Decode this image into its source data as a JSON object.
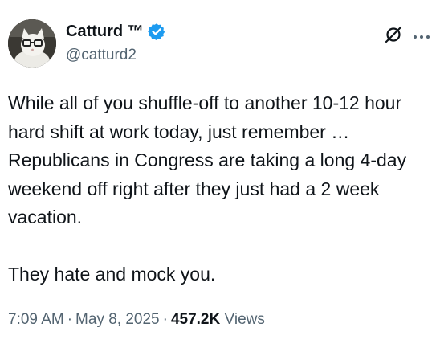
{
  "author": {
    "display_name": "Catturd ™",
    "handle": "@catturd2",
    "verified": true,
    "verified_color": "#1d9bf0"
  },
  "icons": {
    "verified": "verified-badge-icon",
    "grok": "grok-icon",
    "more": "more-options-icon"
  },
  "tweet": {
    "text": "While all of you shuffle-off to another 10-12 hour hard shift at work today, just remember … Republicans in Congress are taking a long 4-day weekend off right after they just had a 2 week vacation.\n\nThey hate and mock you."
  },
  "meta": {
    "time": "7:09 AM",
    "separator": "·",
    "date": "May 8, 2025",
    "views_count": "457.2K",
    "views_label": "Views"
  },
  "colors": {
    "text": "#0f1419",
    "secondary": "#536471"
  }
}
